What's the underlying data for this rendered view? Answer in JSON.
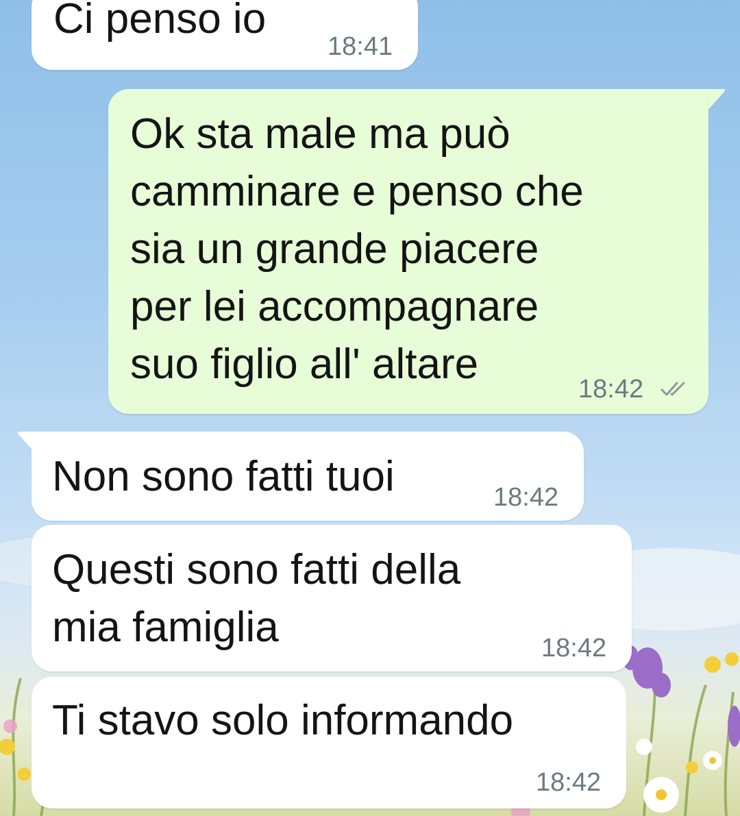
{
  "chat": {
    "messages": [
      {
        "direction": "incoming",
        "text": "Ci penso io",
        "time": "18:41"
      },
      {
        "direction": "outgoing",
        "text": "Ok sta male ma può\ncamminare e penso che\nsia un grande piacere\nper lei accompagnare\nsuo figlio all' altare",
        "time": "18:42",
        "status_icon": "double-check-icon"
      },
      {
        "direction": "incoming",
        "text": "Non sono fatti tuoi",
        "time": "18:42"
      },
      {
        "direction": "incoming",
        "text": "Questi sono fatti della\nmia famiglia",
        "time": "18:42"
      },
      {
        "direction": "incoming",
        "text": "Ti stavo solo informando",
        "time": "18:42"
      }
    ]
  },
  "theme": {
    "incoming_bubble": "#ffffff",
    "outgoing_bubble": "#e7fdd8",
    "timestamp_color": "#6b7a80",
    "check_color": "#8a979c",
    "wallpaper": "sky-and-wildflowers"
  }
}
